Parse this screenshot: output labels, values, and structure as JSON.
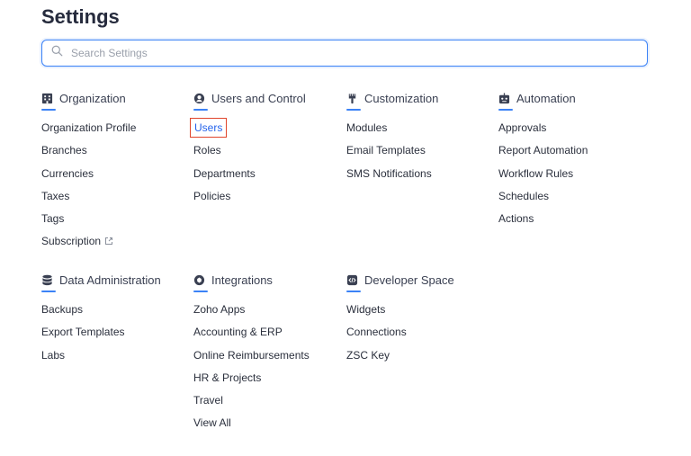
{
  "page": {
    "title": "Settings"
  },
  "search": {
    "placeholder": "Search Settings"
  },
  "accent": "#3b82f6",
  "selected_outline": "#e0452b",
  "sections": {
    "organization": {
      "title": "Organization",
      "icon": "building-icon",
      "items": [
        "Organization Profile",
        "Branches",
        "Currencies",
        "Taxes",
        "Tags",
        "Subscription"
      ]
    },
    "users_control": {
      "title": "Users and Control",
      "icon": "user-circle-icon",
      "items": [
        "Users",
        "Roles",
        "Departments",
        "Policies"
      ],
      "selected": "Users"
    },
    "customization": {
      "title": "Customization",
      "icon": "brush-icon",
      "items": [
        "Modules",
        "Email Templates",
        "SMS Notifications"
      ]
    },
    "automation": {
      "title": "Automation",
      "icon": "robot-icon",
      "items": [
        "Approvals",
        "Report Automation",
        "Workflow Rules",
        "Schedules",
        "Actions"
      ]
    },
    "data_admin": {
      "title": "Data Administration",
      "icon": "database-icon",
      "items": [
        "Backups",
        "Export Templates",
        "Labs"
      ]
    },
    "integrations": {
      "title": "Integrations",
      "icon": "integration-icon",
      "items": [
        "Zoho Apps",
        "Accounting & ERP",
        "Online Reimbursements",
        "HR & Projects",
        "Travel",
        "View All"
      ]
    },
    "developer": {
      "title": "Developer Space",
      "icon": "code-icon",
      "items": [
        "Widgets",
        "Connections",
        "ZSC Key"
      ]
    }
  }
}
